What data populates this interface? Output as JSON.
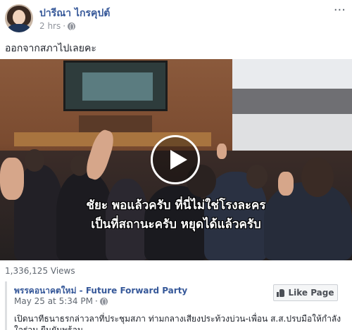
{
  "post": {
    "author": "ปารีณา ไกรคุปต์",
    "time": "2 hrs",
    "dot": "·",
    "more": "···",
    "text": "ออกจากสภาไปเลยคะ"
  },
  "video": {
    "subtitle_line1": "ชัยะ พอแล้วครับ ที่นี่ไม่ใช่โรงละคร",
    "subtitle_line2": "เป็นที่สถานะครับ หยุดได้แล้วครับ",
    "views": "1,336,125 Views"
  },
  "shared": {
    "page_name": "พรรคอนาคตใหม่ - Future Forward Party",
    "date": "May 25 at 5:34 PM",
    "dot": "·",
    "like_page": "Like Page",
    "text": "เปิดนาทีธนาธรกล่าวลาที่ประชุมสภา ท่ามกลางเสียงประท้วงบ่วน-เพื่อน ส.ส.ปรบมือให้กำลังใจร่วม ยืนยันพร้อม"
  },
  "icons": {
    "globe": "globe-icon",
    "play": "play-icon",
    "thumb": "thumbs-up-icon",
    "more": "more-options-icon"
  }
}
